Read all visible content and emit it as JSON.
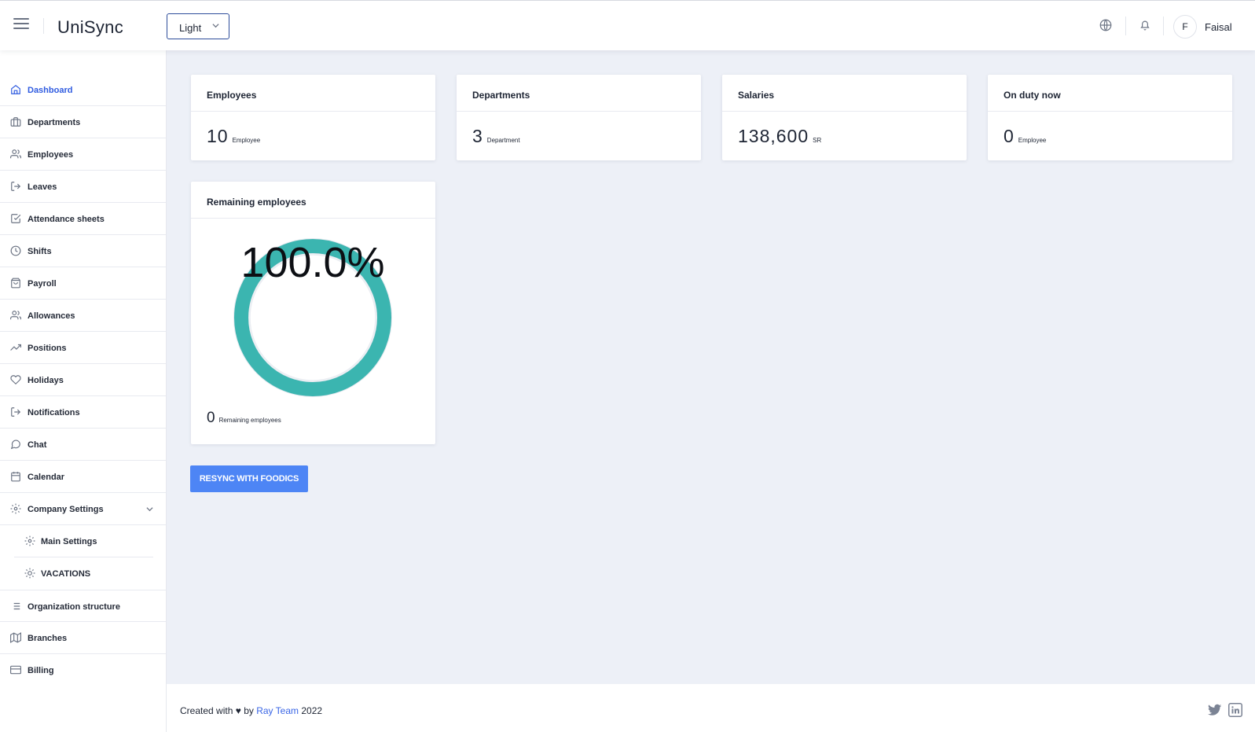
{
  "header": {
    "app_title": "UniSync",
    "theme": "Light",
    "user_initial": "F",
    "user_name": "Faisal"
  },
  "sidebar": {
    "items": [
      {
        "label": "Dashboard",
        "icon": "home-icon",
        "active": true
      },
      {
        "label": "Departments",
        "icon": "briefcase-icon"
      },
      {
        "label": "Employees",
        "icon": "users-icon"
      },
      {
        "label": "Leaves",
        "icon": "log-out-icon"
      },
      {
        "label": "Attendance sheets",
        "icon": "check-square-icon"
      },
      {
        "label": "Shifts",
        "icon": "clock-icon"
      },
      {
        "label": "Payroll",
        "icon": "shopping-bag-icon"
      },
      {
        "label": "Allowances",
        "icon": "users-icon"
      },
      {
        "label": "Positions",
        "icon": "trending-up-icon"
      },
      {
        "label": "Holidays",
        "icon": "heart-icon"
      },
      {
        "label": "Notifications",
        "icon": "log-out-icon"
      },
      {
        "label": "Chat",
        "icon": "message-circle-icon"
      },
      {
        "label": "Calendar",
        "icon": "calendar-icon"
      },
      {
        "label": "Company Settings",
        "icon": "settings-icon",
        "expanded": true
      },
      {
        "label": "Main Settings",
        "icon": "settings-icon",
        "sub": true
      },
      {
        "label": "VACATIONS",
        "icon": "sun-icon",
        "sub": true
      },
      {
        "label": "Organization structure",
        "icon": "list-icon"
      },
      {
        "label": "Branches",
        "icon": "map-icon"
      },
      {
        "label": "Billing",
        "icon": "credit-card-icon"
      }
    ]
  },
  "cards": {
    "employees": {
      "title": "Employees",
      "value": "10",
      "unit": "Employee"
    },
    "departments": {
      "title": "Departments",
      "value": "3",
      "unit": "Department"
    },
    "salaries": {
      "title": "Salaries",
      "value": "138,600",
      "unit": "SR"
    },
    "on_duty": {
      "title": "On duty now",
      "value": "0",
      "unit": "Employee"
    },
    "remaining": {
      "title": "Remaining employees",
      "percent_label": "100.0%",
      "fraction": 1.0,
      "value": "0",
      "unit": "Remaining employees",
      "ring_color": "#3bb5b0"
    }
  },
  "actions": {
    "resync_label": "Resync with Foodics"
  },
  "footer": {
    "prefix": "Created with",
    "heart": "♥",
    "by": "by",
    "team": "Ray Team",
    "year": "2022"
  },
  "colors": {
    "accent": "#2f5be0",
    "button": "#4d85f5",
    "ring": "#3bb5b0"
  }
}
